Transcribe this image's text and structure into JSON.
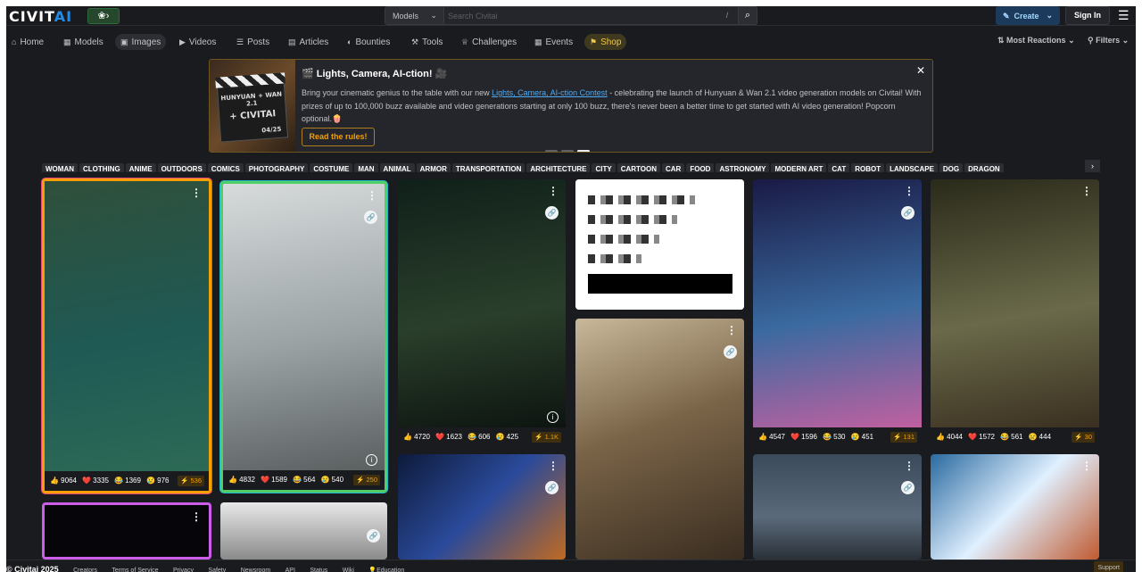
{
  "header": {
    "logo_main": "CIVIT",
    "logo_ai": "AI",
    "flag_label": "❀›",
    "search_scope": "Models",
    "search_placeholder": "Search Civitai",
    "search_shortcut": "/",
    "create_label": "Create",
    "signin_label": "Sign In"
  },
  "nav": {
    "items": [
      {
        "label": "Home",
        "icon": "home-icon"
      },
      {
        "label": "Models",
        "icon": "models-icon"
      },
      {
        "label": "Images",
        "icon": "images-icon"
      },
      {
        "label": "Videos",
        "icon": "videos-icon"
      },
      {
        "label": "Posts",
        "icon": "posts-icon"
      },
      {
        "label": "Articles",
        "icon": "articles-icon"
      },
      {
        "label": "Bounties",
        "icon": "bounties-icon"
      },
      {
        "label": "Tools",
        "icon": "tools-icon"
      },
      {
        "label": "Challenges",
        "icon": "challenges-icon"
      },
      {
        "label": "Events",
        "icon": "events-icon"
      },
      {
        "label": "Shop",
        "icon": "shop-icon"
      }
    ],
    "active": "Images",
    "sort_label": "Most Reactions",
    "filters_label": "Filters"
  },
  "banner": {
    "title": "🎬 Lights, Camera, AI-ction! 🎥",
    "text_before_link": "Bring your cinematic genius to the table with our new ",
    "link_text": "Lights, Camera, AI-ction Contest",
    "text_after_link": " - celebrating the launch of Hunyuan & Wan 2.1 video generation models on Civitai! With prizes of up to 100,000 buzz available and video generations starting at only 100 buzz, there's never been a better time to get started with AI video generation! Popcorn optional.🍿",
    "cta_label": "Read the rules!",
    "image_text_line1": "HUNYUAN + WAN 2.1",
    "image_text_line2": "+ CIVITAI",
    "image_date": "04/25"
  },
  "tags": [
    "WOMAN",
    "CLOTHING",
    "ANIME",
    "OUTDOORS",
    "COMICS",
    "PHOTOGRAPHY",
    "COSTUME",
    "MAN",
    "ANIMAL",
    "ARMOR",
    "TRANSPORTATION",
    "ARCHITECTURE",
    "CITY",
    "CARTOON",
    "CAR",
    "FOOD",
    "ASTRONOMY",
    "MODERN ART",
    "CAT",
    "ROBOT",
    "LANDSCAPE",
    "DOG",
    "DRAGON"
  ],
  "cards": [
    {
      "like": "9064",
      "heart": "3335",
      "laugh": "1369",
      "cry": "976",
      "buzz": "536",
      "colors": [
        "#2f4f3a",
        "#1f5a55",
        "#2d6a55"
      ],
      "border": "#f59f00"
    },
    {
      "like": "4832",
      "heart": "1589",
      "laugh": "564",
      "cry": "540",
      "buzz": "250",
      "colors": [
        "#d7dbdc",
        "#9aa2a4",
        "#5a5f60"
      ],
      "border": "#51cf66"
    },
    {
      "like": "4720",
      "heart": "1623",
      "laugh": "606",
      "cry": "425",
      "buzz": "1.1K",
      "colors": [
        "#10201a",
        "#2a3f2b",
        "#0d1410"
      ],
      "border": ""
    },
    {
      "like": "",
      "heart": "",
      "laugh": "",
      "cry": "",
      "buzz": "",
      "colors": [
        "#ffffff",
        "#ffffff",
        "#ffffff"
      ],
      "border": ""
    },
    {
      "like": "4547",
      "heart": "1596",
      "laugh": "530",
      "cry": "451",
      "buzz": "131",
      "colors": [
        "#1a1a45",
        "#3a6aa0",
        "#c060a0"
      ],
      "border": ""
    },
    {
      "like": "4044",
      "heart": "1572",
      "laugh": "561",
      "cry": "444",
      "buzz": "30",
      "colors": [
        "#2a2a1a",
        "#6a6a4a",
        "#3a2f20"
      ],
      "border": ""
    }
  ],
  "footer": {
    "copyright": "© Civitai 2025",
    "links": [
      "Creators",
      "Terms of Service",
      "Privacy",
      "Safety",
      "Newsroom",
      "API",
      "Status",
      "Wiki",
      "💡Education"
    ],
    "support_label": "Support"
  }
}
